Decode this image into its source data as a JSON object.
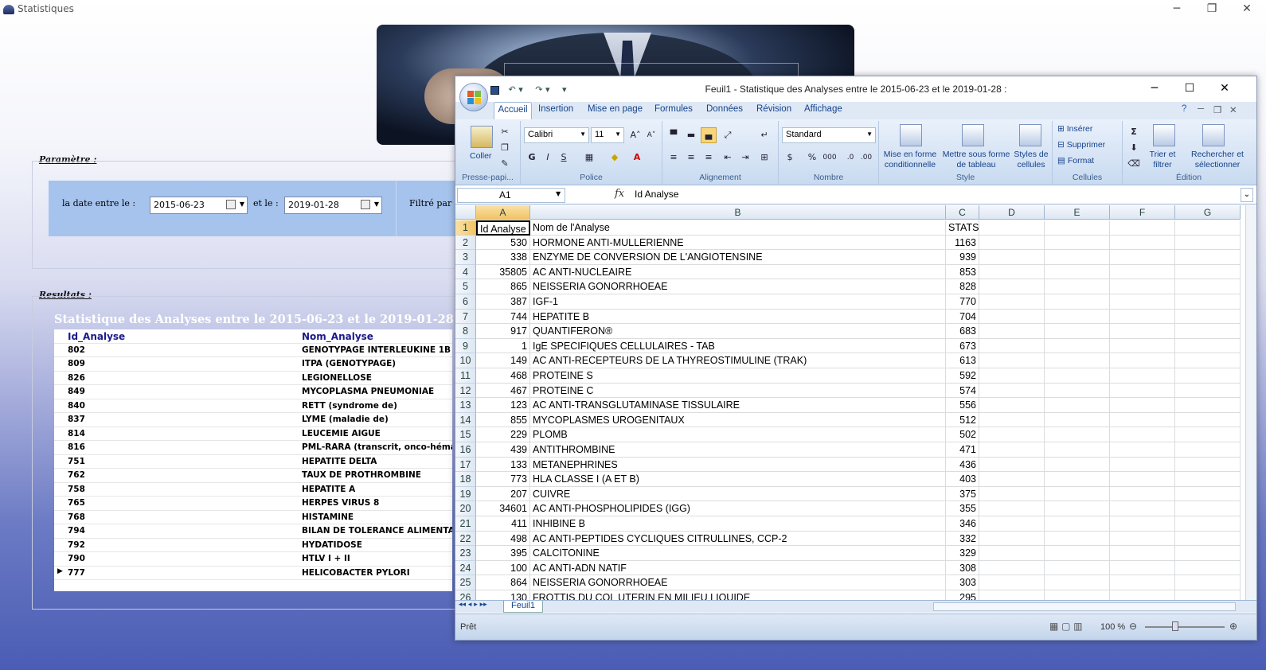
{
  "app": {
    "title": "Statistiques"
  },
  "window_controls": {
    "minimize": "─",
    "restore": "❐",
    "close": "✕"
  },
  "parametre": {
    "label": "Paramètre :",
    "date_label": "la  date entre le :",
    "date_from": "2015-06-23",
    "and_label": "et le :",
    "date_to": "2019-01-28",
    "filter_label": "Filtré par :"
  },
  "resultats": {
    "label": "Resultats :",
    "title": "Statistique des Analyses entre le 2015-06-23 et le 2019-01-28 :",
    "columns": [
      "Id_Analyse",
      "Nom_Analyse"
    ],
    "rows": [
      [
        "802",
        "GENOTYPAGE INTERLEUKINE 1B"
      ],
      [
        "809",
        "ITPA (GENOTYPAGE)"
      ],
      [
        "826",
        "LEGIONELLOSE"
      ],
      [
        "849",
        "MYCOPLASMA PNEUMONIAE"
      ],
      [
        "840",
        "RETT (syndrome de)"
      ],
      [
        "837",
        "LYME (maladie de)"
      ],
      [
        "814",
        "LEUCEMIE AIGUE"
      ],
      [
        "816",
        "PML-RARA (transcrit, onco-héma"
      ],
      [
        "751",
        "HEPATITE DELTA"
      ],
      [
        "762",
        "TAUX DE PROTHROMBINE"
      ],
      [
        "758",
        "HEPATITE A"
      ],
      [
        "765",
        "HERPES VIRUS 8"
      ],
      [
        "768",
        "HISTAMINE"
      ],
      [
        "794",
        "BILAN DE TOLERANCE ALIMENTAIR"
      ],
      [
        "792",
        "HYDATIDOSE"
      ],
      [
        "790",
        "HTLV I + II"
      ],
      [
        "777",
        "HELICOBACTER PYLORI"
      ]
    ],
    "current_row_marker": "▶"
  },
  "excel": {
    "title": "Feuil1 - Statistique des Analyses entre le 2015-06-23 et le 2019-01-28 :",
    "window_controls": {
      "minimize": "─",
      "maximize": "☐",
      "close": "✕"
    },
    "tabs": [
      "Accueil",
      "Insertion",
      "Mise en page",
      "Formules",
      "Données",
      "Révision",
      "Affichage"
    ],
    "ribbon": {
      "clipboard": {
        "paste": "Coller",
        "label": "Presse-papi..."
      },
      "font": {
        "name": "Calibri",
        "size": "11",
        "label": "Police",
        "bold": "G",
        "italic": "I",
        "underline": "S"
      },
      "alignment": {
        "label": "Alignement"
      },
      "number": {
        "format": "Standard",
        "label": "Nombre",
        "percent": "%",
        "thousands": "000"
      },
      "style": {
        "cond_format": "Mise en forme conditionnelle",
        "table_format": "Mettre sous forme de tableau",
        "cell_styles": "Styles de cellules",
        "label": "Style"
      },
      "cells": {
        "insert": "Insérer",
        "delete": "Supprimer",
        "format": "Format",
        "label": "Cellules"
      },
      "editing": {
        "sort": "Trier et filtrer",
        "find": "Rechercher et sélectionner",
        "label": "Édition"
      }
    },
    "name_box": "A1",
    "formula": "Id Analyse",
    "columns": [
      "A",
      "B",
      "C",
      "D",
      "E",
      "F",
      "G"
    ],
    "rows": [
      [
        "1",
        "Id Analyse",
        "Nom de l'Analyse",
        "STATS"
      ],
      [
        "2",
        "530",
        "HORMONE ANTI-MULLERIENNE",
        "1163"
      ],
      [
        "3",
        "338",
        "ENZYME DE CONVERSION DE L'ANGIOTENSINE",
        "939"
      ],
      [
        "4",
        "35805",
        "AC ANTI-NUCLEAIRE",
        "853"
      ],
      [
        "5",
        "865",
        "NEISSERIA GONORRHOEAE",
        "828"
      ],
      [
        "6",
        "387",
        "IGF-1",
        "770"
      ],
      [
        "7",
        "744",
        "HEPATITE B",
        "704"
      ],
      [
        "8",
        "917",
        "QUANTIFERON®",
        "683"
      ],
      [
        "9",
        "1",
        "IgE SPECIFIQUES CELLULAIRES - TAB",
        "673"
      ],
      [
        "10",
        "149",
        "AC ANTI-RECEPTEURS DE LA THYREOSTIMULINE (TRAK)",
        "613"
      ],
      [
        "11",
        "468",
        "PROTEINE S",
        "592"
      ],
      [
        "12",
        "467",
        "PROTEINE C",
        "574"
      ],
      [
        "13",
        "123",
        "AC ANTI-TRANSGLUTAMINASE TISSULAIRE",
        "556"
      ],
      [
        "14",
        "855",
        "MYCOPLASMES UROGENITAUX",
        "512"
      ],
      [
        "15",
        "229",
        "PLOMB",
        "502"
      ],
      [
        "16",
        "439",
        "ANTITHROMBINE",
        "471"
      ],
      [
        "17",
        "133",
        "METANEPHRINES",
        "436"
      ],
      [
        "18",
        "773",
        "HLA CLASSE I (A ET B)",
        "403"
      ],
      [
        "19",
        "207",
        "CUIVRE",
        "375"
      ],
      [
        "20",
        "34601",
        "AC ANTI-PHOSPHOLIPIDES (IGG)",
        "355"
      ],
      [
        "21",
        "411",
        "INHIBINE B",
        "346"
      ],
      [
        "22",
        "498",
        "AC ANTI-PEPTIDES CYCLIQUES CITRULLINES, CCP-2",
        "332"
      ],
      [
        "23",
        "395",
        "CALCITONINE",
        "329"
      ],
      [
        "24",
        "100",
        "AC ANTI-ADN NATIF",
        "308"
      ],
      [
        "25",
        "864",
        "NEISSERIA GONORRHOEAE",
        "303"
      ],
      [
        "26",
        "130",
        "FROTTIS DU COL UTERIN EN MILIEU LIQUIDE",
        "295"
      ]
    ],
    "sheet_tab": "Feuil1",
    "status": "Prêt",
    "zoom": "100 %"
  }
}
